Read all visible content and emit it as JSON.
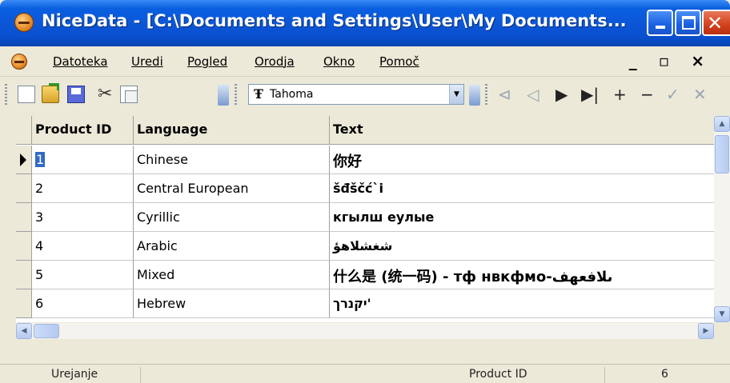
{
  "window": {
    "title": "NiceData - [C:\\Documents and Settings\\User\\My Documents...",
    "controls": [
      "minimize",
      "maximize",
      "close"
    ]
  },
  "menu": {
    "items": [
      "Datoteka",
      "Uredi",
      "Pogled",
      "Orodja",
      "Okno",
      "Pomoč"
    ],
    "mdi_controls": "_ ▫ ×"
  },
  "toolbar": {
    "font_icon": "Ŧ",
    "font_name": "Tahoma",
    "cut_glyph": "✂",
    "nav": [
      "⊲",
      "◁",
      "▶",
      "▶|",
      "+",
      "−",
      "✓",
      "✕"
    ]
  },
  "grid": {
    "columns": [
      "Product ID",
      "Language",
      "Text"
    ],
    "rows": [
      {
        "id": "1",
        "language": "Chinese",
        "text": "你好"
      },
      {
        "id": "2",
        "language": "Central European",
        "text": "šđščć`i"
      },
      {
        "id": "3",
        "language": "Cyrillic",
        "text": "кгылш еулые"
      },
      {
        "id": "4",
        "language": "Arabic",
        "text": "شغشلاهؤ"
      },
      {
        "id": "5",
        "language": "Mixed",
        "text": "什么是 (统一码) - тф нвкфмо-ىلافعهف"
      },
      {
        "id": "6",
        "language": "Hebrew",
        "text": "יקנרך'"
      }
    ],
    "selected_row": 1
  },
  "statusbar": {
    "mode": "Urejanje",
    "field": "Product ID",
    "count": "6"
  }
}
